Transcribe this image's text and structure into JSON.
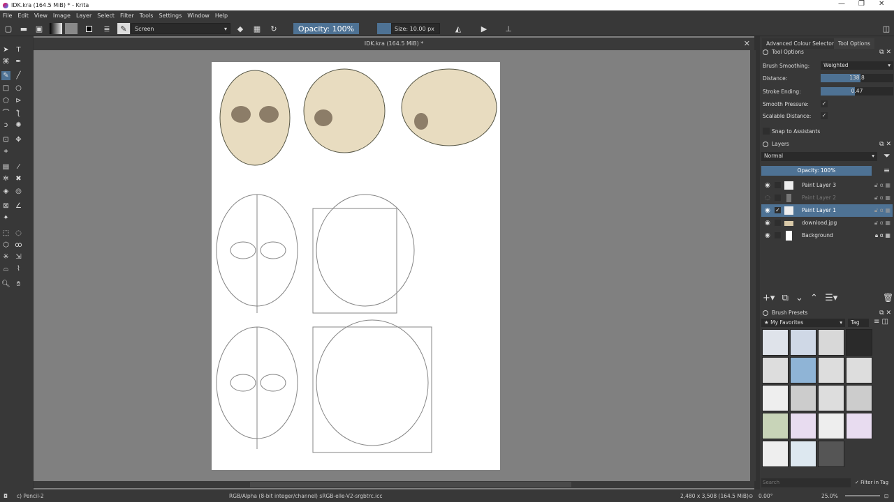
{
  "window": {
    "title": "IDK.kra (164.5 MiB) * - Krita",
    "minimize": "—",
    "maximize": "❐",
    "close": "✕"
  },
  "menu": [
    "File",
    "Edit",
    "View",
    "Image",
    "Layer",
    "Select",
    "Filter",
    "Tools",
    "Settings",
    "Window",
    "Help"
  ],
  "toolbar": {
    "blend_mode": "Screen",
    "opacity": "Opacity: 100%",
    "size": "Size: 10.00 px"
  },
  "canvas": {
    "tab_title": "IDK.kra (164.5 MiB) *",
    "close": "✕"
  },
  "docker": {
    "tabs": [
      "Advanced Colour Selector",
      "Tool Options"
    ],
    "tool_options": {
      "title": "Tool Options",
      "brush_smoothing_label": "Brush Smoothing:",
      "brush_smoothing": "Weighted",
      "distance_label": "Distance:",
      "distance": "138.8",
      "distance_fraction": 0.55,
      "stroke_ending_label": "Stroke Ending:",
      "stroke_ending": "0.47",
      "stroke_ending_fraction": 0.47,
      "smooth_pressure_label": "Smooth Pressure:",
      "scalable_distance_label": "Scalable Distance:",
      "snap_label": "Snap to Assistants",
      "check": "✓"
    },
    "layers": {
      "title": "Layers",
      "blend": "Normal",
      "opacity": "Opacity:  100%",
      "items": [
        {
          "name": "Paint Layer 3"
        },
        {
          "name": "Paint Layer 2"
        },
        {
          "name": "Paint Layer 1"
        },
        {
          "name": "download.jpg"
        },
        {
          "name": "Background"
        }
      ]
    },
    "brush_presets": {
      "title": "Brush Presets",
      "tag": "★ My Favorites",
      "tag_button": "Tag",
      "search_placeholder": "Search",
      "filter_in_tag": "Filter in Tag"
    }
  },
  "status": {
    "tool": "c) Pencil-2",
    "color_space": "RGB/Alpha (8-bit integer/channel)  sRGB-elle-V2-srgbtrc.icc",
    "dimensions": "2,480 x 3,508 (164.5 MiB)",
    "rotation": "0.00°",
    "zoom": "25.0%"
  }
}
